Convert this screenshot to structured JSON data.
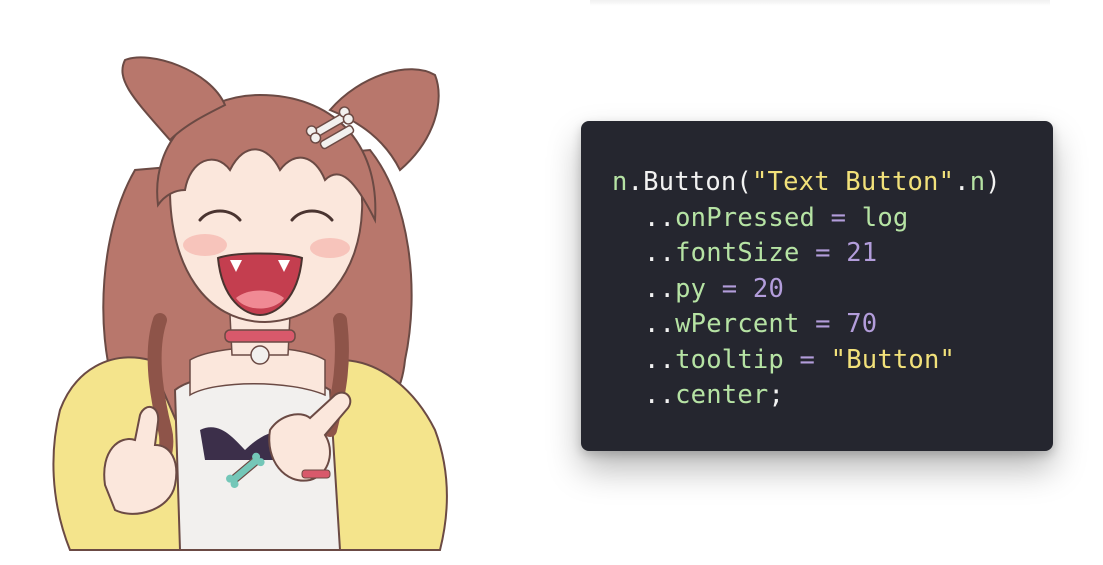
{
  "illustration": {
    "subject": "anime girl with dog ears laughing and giving thumbs up",
    "colors": {
      "hair": "#b8776c",
      "hair_dark": "#8e5449",
      "skin": "#fbe7dc",
      "blush": "#f5b8b0",
      "jacket": "#f4e48c",
      "shirt": "#f2f0ee",
      "collar": "#d8596b",
      "bone_accent": "#74c7b8",
      "outline": "#6b4a44"
    }
  },
  "code": {
    "background": "#25262f",
    "lines": [
      {
        "indent": 0,
        "tokens": [
          {
            "t": "var",
            "text": "n"
          },
          {
            "t": "plain",
            "text": ".Button("
          },
          {
            "t": "str",
            "text": "\"Text Button\""
          },
          {
            "t": "plain",
            "text": "."
          },
          {
            "t": "var",
            "text": "n"
          },
          {
            "t": "plain",
            "text": ")"
          }
        ]
      },
      {
        "indent": 1,
        "tokens": [
          {
            "t": "plain",
            "text": ".."
          },
          {
            "t": "prop",
            "text": "onPressed"
          },
          {
            "t": "op",
            "text": " = "
          },
          {
            "t": "var",
            "text": "log"
          }
        ]
      },
      {
        "indent": 1,
        "tokens": [
          {
            "t": "plain",
            "text": ".."
          },
          {
            "t": "prop",
            "text": "fontSize"
          },
          {
            "t": "op",
            "text": " = "
          },
          {
            "t": "num",
            "text": "21"
          }
        ]
      },
      {
        "indent": 1,
        "tokens": [
          {
            "t": "plain",
            "text": ".."
          },
          {
            "t": "prop",
            "text": "py"
          },
          {
            "t": "op",
            "text": " = "
          },
          {
            "t": "num",
            "text": "20"
          }
        ]
      },
      {
        "indent": 1,
        "tokens": [
          {
            "t": "plain",
            "text": ".."
          },
          {
            "t": "prop",
            "text": "wPercent"
          },
          {
            "t": "op",
            "text": " = "
          },
          {
            "t": "num",
            "text": "70"
          }
        ]
      },
      {
        "indent": 1,
        "tokens": [
          {
            "t": "plain",
            "text": ".."
          },
          {
            "t": "prop",
            "text": "tooltip"
          },
          {
            "t": "op",
            "text": " = "
          },
          {
            "t": "str",
            "text": "\"Button\""
          }
        ]
      },
      {
        "indent": 1,
        "tokens": [
          {
            "t": "plain",
            "text": ".."
          },
          {
            "t": "prop",
            "text": "center"
          },
          {
            "t": "plain",
            "text": ";"
          }
        ]
      }
    ]
  }
}
